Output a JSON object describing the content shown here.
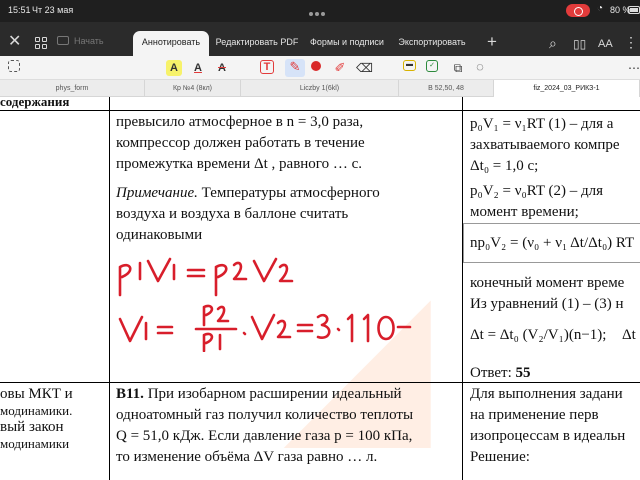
{
  "status_bar": {
    "time": "15:51",
    "date": "Чт 23 мая",
    "battery": "80 %"
  },
  "toolbar": {
    "home_label": "Начать",
    "tabs": [
      {
        "label": "Аннотировать",
        "active": true
      },
      {
        "label": "Редактировать PDF",
        "active": false
      },
      {
        "label": "Формы и подписи",
        "active": false
      },
      {
        "label": "Экспортировать",
        "active": false
      }
    ],
    "add_tab": "+",
    "text_size_label": "AA"
  },
  "annotation_tools": {
    "highlight_label": "A",
    "underline_label": "A",
    "strike_label": "A",
    "text_tool_label": "T"
  },
  "document_tabs": [
    {
      "label": "phys_form",
      "active": false
    },
    {
      "label": "Кр №4 (8кл)",
      "active": false
    },
    {
      "label": "Liczby 1(6kl)",
      "active": false
    },
    {
      "label": "B 52,50, 48",
      "active": false
    },
    {
      "label": "fiz_2024_03_РИКЗ-1",
      "active": true
    }
  ],
  "document": {
    "header_left": "содержания",
    "col1_lines": [
      "овы МКТ и",
      "модинамики.",
      "вый закон",
      "модинамики"
    ],
    "mid_top_lines": [
      "превысило атмосферное в n = 3,0 раза,",
      "компрессор должен работать в течение",
      "промежутка времени Δt , равного … с."
    ],
    "note_label": "Примечание.",
    "note_lines": [
      "Температуры атмосферного",
      "воздуха и воздуха в баллоне считать",
      "одинаковыми"
    ],
    "b11_label": "B11.",
    "b11_lines": [
      "При изобарном расширении идеальный",
      "одноатомный газ получил количество теплоты",
      "Q = 51,0 кДж. Если давление газа p = 100 кПа,",
      "то изменение объёма ΔV газа равно … л."
    ],
    "right_lines": [
      "p₀V₁ = ν₁RT  (1) – для а",
      "захватываемого компре",
      "Δt₀ = 1,0 с;",
      "p₀V₂ = ν₀RT  (2) – для",
      "момент времени;",
      "np₀V₂ = (ν₀ + ν₁ Δt/Δt₀) RT",
      "конечный момент време",
      "Из уравнений (1) – (3) н",
      "Δt = Δt₀ (V₂/V₁)(n−1);",
      "Δt"
    ],
    "answer_label": "Ответ:",
    "answer_value": "55",
    "right_bottom_lines": [
      "Для выполнения задани",
      "на применение перв",
      "изопроцессам в идеальн",
      "Решение:"
    ],
    "handwriting": {
      "line1": "p₁V₁ = p₂V₂",
      "line2": "V₁ = (p₂/p₁)·V₂ = 3·110 −"
    }
  }
}
